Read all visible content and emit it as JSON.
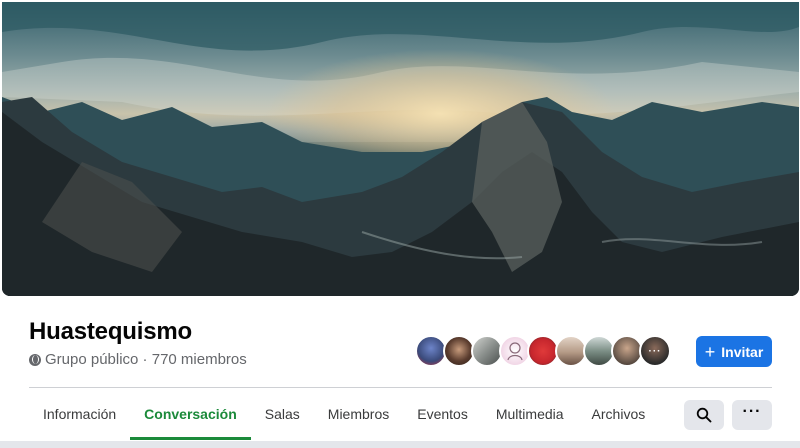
{
  "group": {
    "name": "Huastequismo",
    "privacy_icon": "globe-icon",
    "meta_text": "Grupo público · 770 miembros"
  },
  "cover": {
    "description_colors": {
      "sky": "#6f8f93",
      "sun": "#e6c58e",
      "mountain": "#2a383c"
    }
  },
  "members_preview": {
    "avatars": [
      {
        "name": "member-avatar-1",
        "color": "#3a4a7a"
      },
      {
        "name": "member-avatar-2",
        "color": "#5b3d2f"
      },
      {
        "name": "member-avatar-3",
        "color": "#8a8f8c"
      },
      {
        "name": "member-avatar-4",
        "color": "#f1d6e6"
      },
      {
        "name": "member-avatar-5",
        "color": "#c6262d"
      },
      {
        "name": "member-avatar-6",
        "color": "#b49a86"
      },
      {
        "name": "member-avatar-7",
        "color": "#7c8f86"
      },
      {
        "name": "member-avatar-8",
        "color": "#6b5a4e"
      },
      {
        "name": "member-avatar-9",
        "color": "#2b2b2b"
      }
    ],
    "more_label": "···"
  },
  "actions": {
    "invite_label": "Invitar",
    "invite_icon": "plus-icon",
    "search_icon": "search-icon",
    "more_label": "···"
  },
  "tabs": [
    {
      "label": "Información",
      "active": false
    },
    {
      "label": "Conversación",
      "active": true
    },
    {
      "label": "Salas",
      "active": false
    },
    {
      "label": "Miembros",
      "active": false
    },
    {
      "label": "Eventos",
      "active": false
    },
    {
      "label": "Multimedia",
      "active": false
    },
    {
      "label": "Archivos",
      "active": false
    }
  ],
  "colors": {
    "accent": "#1b74e4",
    "active_tab": "#1b8a3a",
    "text_secondary": "#65676b"
  }
}
